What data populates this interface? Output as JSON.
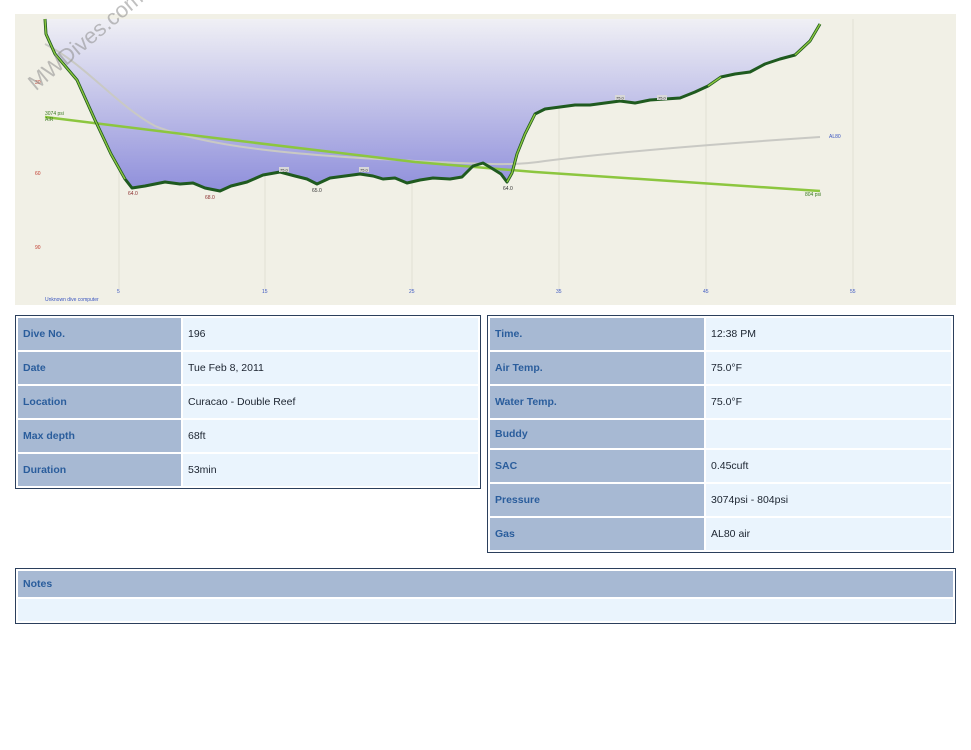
{
  "watermark": "MWDives.com",
  "profile": {
    "depth_ticks": [
      "30",
      "60",
      "90"
    ],
    "time_ticks": [
      "5",
      "15",
      "25",
      "35",
      "45",
      "55"
    ],
    "depth_labels": [
      "64.0",
      "68.0",
      "65.0",
      "64.0"
    ],
    "temp_labels": [
      "75.0",
      "75.0",
      "75.0",
      "75.0"
    ],
    "start_pressure_label": "3074 psi",
    "start_pressure_sublabel": "AIR",
    "end_pressure_label": "804 psi",
    "right_series_label": "AL80",
    "computer_label": "Unknown dive computer",
    "colors": {
      "background": "#f1f0e6",
      "depth_line": "#1f5a1f",
      "depth_fill": "#8f8fdb",
      "pressure_line": "#8cc63f",
      "gray_line": "#c9c9c4",
      "depth_tick": "#c0392b",
      "time_tick": "#3a55c0"
    }
  },
  "dive_info": {
    "rows": [
      {
        "label": "Dive No.",
        "value": "196"
      },
      {
        "label": "Date",
        "value": "Tue Feb 8, 2011"
      },
      {
        "label": "Location",
        "value": "Curacao - Double Reef"
      },
      {
        "label": "Max depth",
        "value": "68ft"
      },
      {
        "label": "Duration",
        "value": "53min"
      }
    ]
  },
  "conditions": {
    "rows": [
      {
        "label": "Time.",
        "value": "12:38 PM"
      },
      {
        "label": "Air Temp.",
        "value": "75.0°F"
      },
      {
        "label": "Water Temp.",
        "value": "75.0°F"
      },
      {
        "label": "Buddy",
        "value": ""
      },
      {
        "label": "SAC",
        "value": "0.45cuft"
      },
      {
        "label": "Pressure",
        "value": "3074psi - 804psi"
      },
      {
        "label": "Gas",
        "value": "AL80 air"
      }
    ]
  },
  "notes": {
    "label": "Notes",
    "text": ""
  }
}
